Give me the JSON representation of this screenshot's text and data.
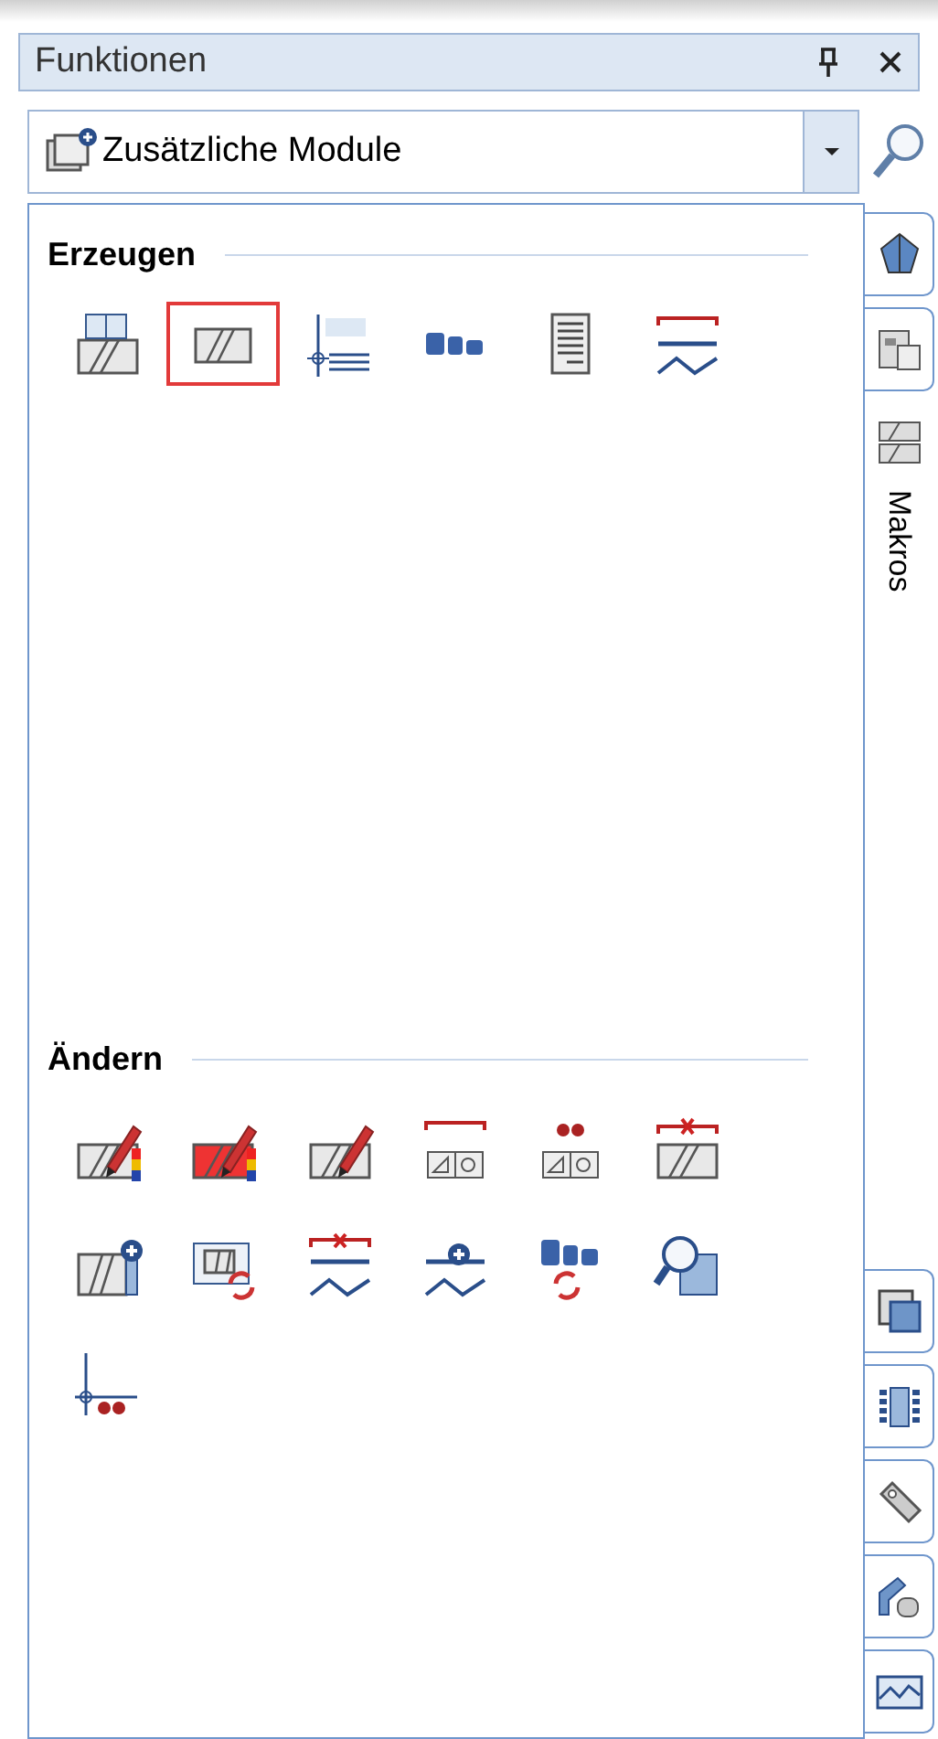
{
  "panel": {
    "title": "Funktionen"
  },
  "module_select": {
    "value": "Zusätzliche Module"
  },
  "sections": [
    {
      "heading": "Erzeugen",
      "tools": [
        {
          "selected": false
        },
        {
          "selected": true
        },
        {
          "selected": false
        },
        {
          "selected": false
        },
        {
          "selected": false
        },
        {
          "selected": false
        }
      ]
    },
    {
      "heading": "Ändern",
      "tools": [
        {
          "selected": false
        },
        {
          "selected": false
        },
        {
          "selected": false
        },
        {
          "selected": false
        },
        {
          "selected": false
        },
        {
          "selected": false
        },
        {
          "selected": false
        },
        {
          "selected": false
        },
        {
          "selected": false
        },
        {
          "selected": false
        },
        {
          "selected": false
        },
        {
          "selected": false
        },
        {
          "selected": false
        }
      ]
    }
  ],
  "side_tabs_top": [
    {
      "selected": false
    },
    {
      "selected": false
    },
    {
      "label": "Makros",
      "selected": true
    }
  ],
  "side_tabs_bottom": [
    {
      "selected": false
    },
    {
      "selected": false
    },
    {
      "selected": false
    },
    {
      "selected": false
    },
    {
      "selected": false
    }
  ]
}
